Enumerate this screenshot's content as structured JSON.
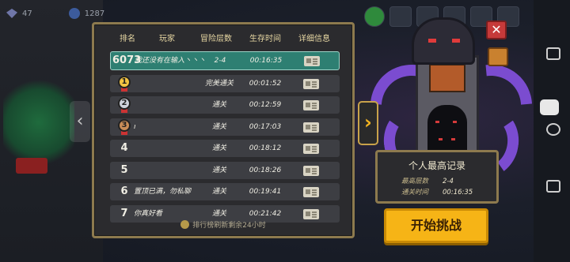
{
  "top_currency": {
    "gems": "47",
    "coins": "1287"
  },
  "leaderboard": {
    "headers": {
      "rank": "排名",
      "player": "玩家",
      "floor": "冒险层数",
      "time": "生存时间",
      "detail": "详细信息"
    },
    "rows": [
      {
        "rank": "6073",
        "player": "我还没有在输入丶丶丶",
        "floor": "2-4",
        "time": "00:16:35",
        "highlight": true
      },
      {
        "rank": "1",
        "medal": "gold",
        "player": "",
        "floor": "完美通关",
        "time": "00:01:52"
      },
      {
        "rank": "2",
        "medal": "silver",
        "player": "",
        "floor": "通关",
        "time": "00:12:59"
      },
      {
        "rank": "3",
        "medal": "bronze",
        "player": "ı",
        "floor": "通关",
        "time": "00:17:03"
      },
      {
        "rank": "4",
        "player": "",
        "floor": "通关",
        "time": "00:18:12"
      },
      {
        "rank": "5",
        "player": "",
        "floor": "通关",
        "time": "00:18:26"
      },
      {
        "rank": "6",
        "player": "置顶已满，勿私聊",
        "floor": "通关",
        "time": "00:19:41"
      },
      {
        "rank": "7",
        "player": "你真好看",
        "floor": "通关",
        "time": "00:21:42"
      }
    ],
    "footer": "排行榜刷新剩余24小时"
  },
  "personal_best": {
    "title": "个人最高记录",
    "floor_label": "最高层数",
    "floor_value": "2-4",
    "time_label": "通关时间",
    "time_value": "00:16:35"
  },
  "start_button": "开始挑战",
  "close_button": "✕",
  "side_arrows": {
    "left": "‹",
    "right": "›"
  }
}
